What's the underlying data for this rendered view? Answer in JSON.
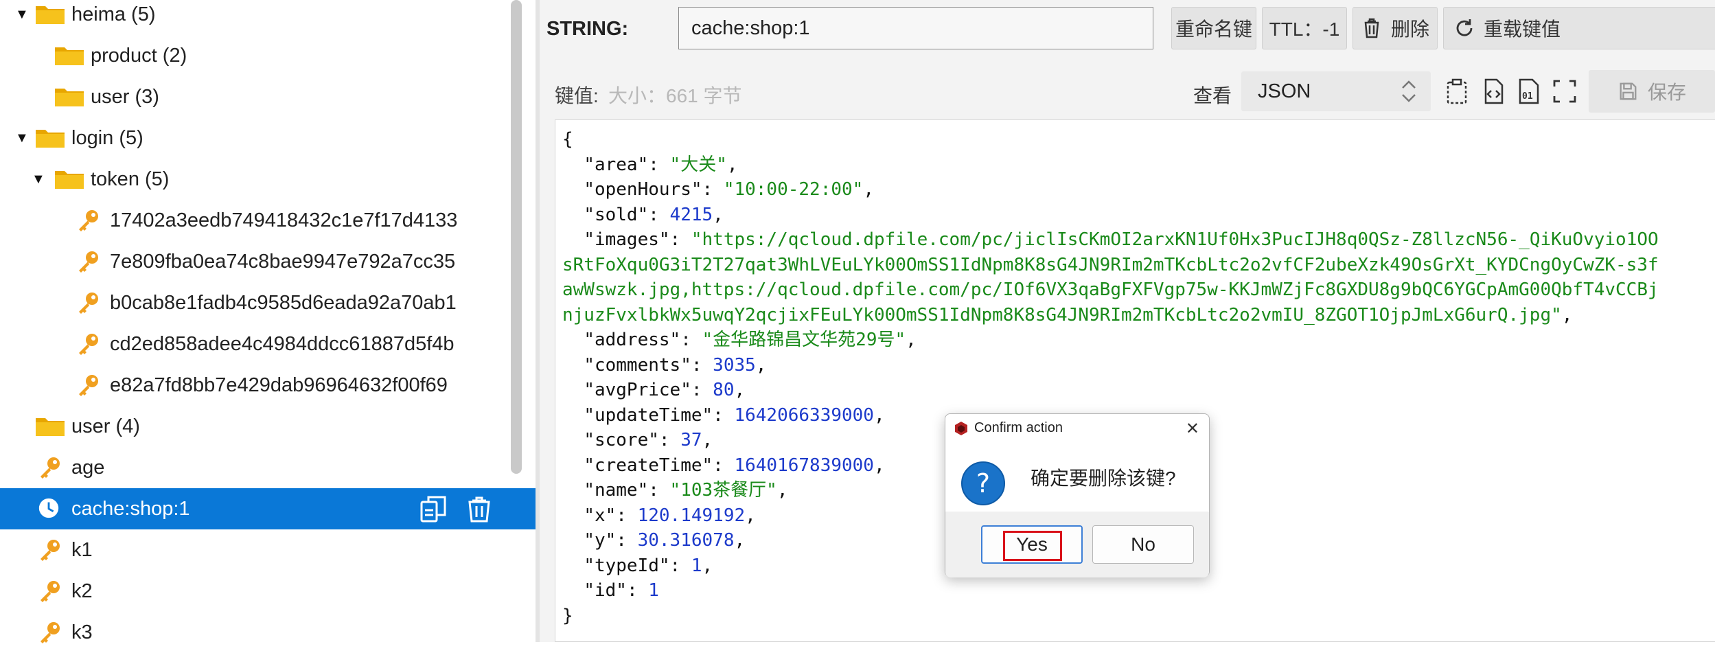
{
  "tree": {
    "rows": [
      {
        "label": "heima (5)",
        "type": "folder",
        "expanded": true
      },
      {
        "label": "product (2)",
        "type": "folder",
        "expanded": false
      },
      {
        "label": "user (3)",
        "type": "folder",
        "expanded": false
      },
      {
        "label": "login (5)",
        "type": "folder",
        "expanded": true
      },
      {
        "label": "token (5)",
        "type": "folder",
        "expanded": true
      },
      {
        "label": "17402a3eedb749418432c1e7f17d4133",
        "type": "key"
      },
      {
        "label": "7e809fba0ea74c8bae9947e792a7cc35",
        "type": "key"
      },
      {
        "label": "b0cab8e1fadb4c9585d6eada92a70ab1",
        "type": "key"
      },
      {
        "label": "cd2ed858adee4c4984ddcc61887d5f4b",
        "type": "key"
      },
      {
        "label": "e82a7fd8bb7e429dab96964632f00f69",
        "type": "key"
      },
      {
        "label": "user (4)",
        "type": "folder",
        "expanded": false
      },
      {
        "label": "age",
        "type": "key"
      },
      {
        "label": "cache:shop:1",
        "type": "ttl-key",
        "selected": true
      },
      {
        "label": "k1",
        "type": "key"
      },
      {
        "label": "k2",
        "type": "key"
      },
      {
        "label": "k3",
        "type": "key"
      }
    ]
  },
  "detail": {
    "type_label": "STRING:",
    "key_name": "cache:shop:1",
    "rename_label": "重命名键",
    "ttl_label": "TTL：-1",
    "delete_label": "删除",
    "reload_label": "重载键值",
    "value_label": "键值:",
    "size_label": "大小：661 字节",
    "view_label": "查看",
    "view_format": "JSON",
    "save_label": "保存"
  },
  "json_lines": [
    [
      [
        "p",
        "{"
      ]
    ],
    [
      [
        "p",
        "  "
      ],
      [
        "k",
        "\"area\""
      ],
      [
        "p",
        ": "
      ],
      [
        "s",
        "\"大关\""
      ],
      [
        "p",
        ","
      ]
    ],
    [
      [
        "p",
        "  "
      ],
      [
        "k",
        "\"openHours\""
      ],
      [
        "p",
        ": "
      ],
      [
        "s",
        "\"10:00-22:00\""
      ],
      [
        "p",
        ","
      ]
    ],
    [
      [
        "p",
        "  "
      ],
      [
        "k",
        "\"sold\""
      ],
      [
        "p",
        ": "
      ],
      [
        "n",
        "4215"
      ],
      [
        "p",
        ","
      ]
    ],
    [
      [
        "p",
        "  "
      ],
      [
        "k",
        "\"images\""
      ],
      [
        "p",
        ": "
      ],
      [
        "s",
        "\"https://qcloud.dpfile.com/pc/jiclIsCKmOI2arxKN1Uf0Hx3PucIJH8q0QSz-Z8llzcN56-_QiKuOvyio1OO"
      ]
    ],
    [
      [
        "s",
        "sRtFoXqu0G3iT2T27qat3WhLVEuLYk00OmSS1IdNpm8K8sG4JN9RIm2mTKcbLtc2o2vfCF2ubeXzk49OsGrXt_KYDCngOyCwZK-s3f"
      ]
    ],
    [
      [
        "s",
        "awWswzk.jpg,https://qcloud.dpfile.com/pc/IOf6VX3qaBgFXFVgp75w-KKJmWZjFc8GXDU8g9bQC6YGCpAmG00QbfT4vCCBj"
      ]
    ],
    [
      [
        "s",
        "njuzFvxlbkWx5uwqY2qcjixFEuLYk00OmSS1IdNpm8K8sG4JN9RIm2mTKcbLtc2o2vmIU_8ZGOT1OjpJmLxG6urQ.jpg\""
      ],
      [
        "p",
        ","
      ]
    ],
    [
      [
        "p",
        "  "
      ],
      [
        "k",
        "\"address\""
      ],
      [
        "p",
        ": "
      ],
      [
        "s",
        "\"金华路锦昌文华苑29号\""
      ],
      [
        "p",
        ","
      ]
    ],
    [
      [
        "p",
        "  "
      ],
      [
        "k",
        "\"comments\""
      ],
      [
        "p",
        ": "
      ],
      [
        "n",
        "3035"
      ],
      [
        "p",
        ","
      ]
    ],
    [
      [
        "p",
        "  "
      ],
      [
        "k",
        "\"avgPrice\""
      ],
      [
        "p",
        ": "
      ],
      [
        "n",
        "80"
      ],
      [
        "p",
        ","
      ]
    ],
    [
      [
        "p",
        "  "
      ],
      [
        "k",
        "\"updateTime\""
      ],
      [
        "p",
        ": "
      ],
      [
        "n",
        "1642066339000"
      ],
      [
        "p",
        ","
      ]
    ],
    [
      [
        "p",
        "  "
      ],
      [
        "k",
        "\"score\""
      ],
      [
        "p",
        ": "
      ],
      [
        "n",
        "37"
      ],
      [
        "p",
        ","
      ]
    ],
    [
      [
        "p",
        "  "
      ],
      [
        "k",
        "\"createTime\""
      ],
      [
        "p",
        ": "
      ],
      [
        "n",
        "1640167839000"
      ],
      [
        "p",
        ","
      ]
    ],
    [
      [
        "p",
        "  "
      ],
      [
        "k",
        "\"name\""
      ],
      [
        "p",
        ": "
      ],
      [
        "s",
        "\"103茶餐厅\""
      ],
      [
        "p",
        ","
      ]
    ],
    [
      [
        "p",
        "  "
      ],
      [
        "k",
        "\"x\""
      ],
      [
        "p",
        ": "
      ],
      [
        "n",
        "120.149192"
      ],
      [
        "p",
        ","
      ]
    ],
    [
      [
        "p",
        "  "
      ],
      [
        "k",
        "\"y\""
      ],
      [
        "p",
        ": "
      ],
      [
        "n",
        "30.316078"
      ],
      [
        "p",
        ","
      ]
    ],
    [
      [
        "p",
        "  "
      ],
      [
        "k",
        "\"typeId\""
      ],
      [
        "p",
        ": "
      ],
      [
        "n",
        "1"
      ],
      [
        "p",
        ","
      ]
    ],
    [
      [
        "p",
        "  "
      ],
      [
        "k",
        "\"id\""
      ],
      [
        "p",
        ": "
      ],
      [
        "n",
        "1"
      ]
    ],
    [
      [
        "p",
        "}"
      ]
    ]
  ],
  "dialog": {
    "title": "Confirm action",
    "message": "确定要删除该键?",
    "yes_label": "Yes",
    "no_label": "No"
  },
  "colors": {
    "selection": "#0a78d7",
    "folder": "#f6b800",
    "key": "#f0a020",
    "string": "#1a8a1a",
    "number": "#1c3acb"
  }
}
